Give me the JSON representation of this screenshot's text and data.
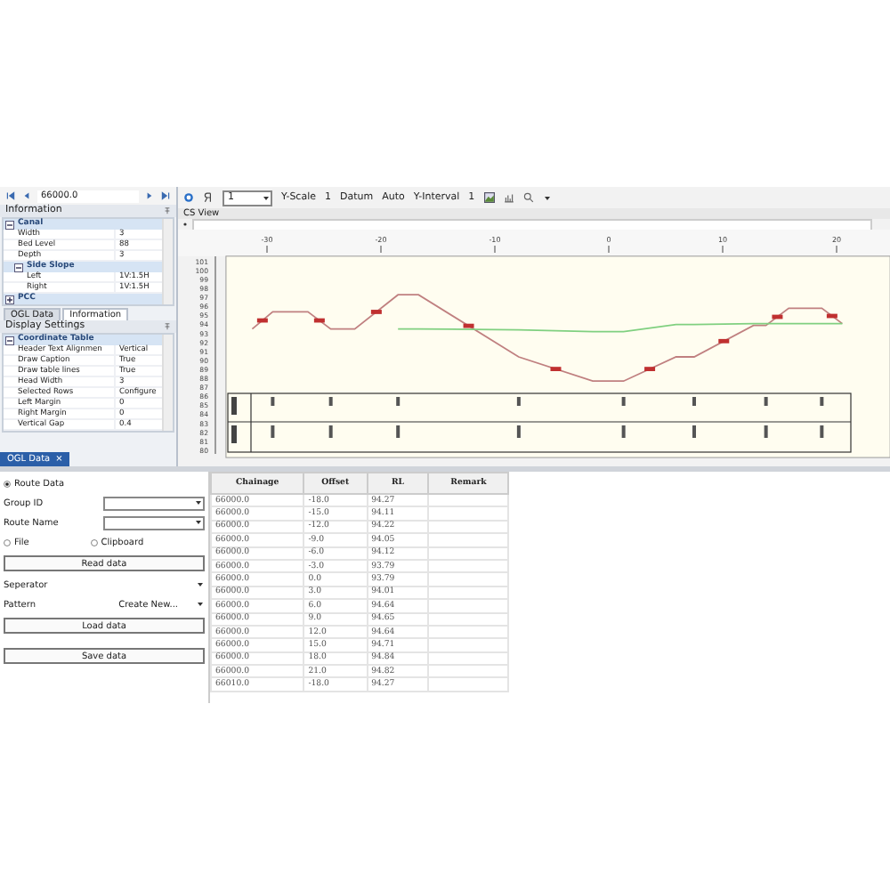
{
  "navigator": {
    "value": "66000.0"
  },
  "toolbar": {
    "scale_select": "1",
    "y_scale": {
      "label": "Y-Scale",
      "value": "1"
    },
    "datum": {
      "label": "Datum",
      "value": "Auto"
    },
    "y_interval": {
      "label": "Y-Interval",
      "value": "1"
    }
  },
  "information": {
    "title": "Information",
    "properties": [
      {
        "kind": "group",
        "label": "Canal",
        "expanded": true,
        "children": [
          {
            "kind": "row",
            "label": "Width",
            "value": "3"
          },
          {
            "kind": "row",
            "label": "Bed Level",
            "value": "88"
          },
          {
            "kind": "row",
            "label": "Depth",
            "value": "3"
          },
          {
            "kind": "group",
            "label": "Side Slope",
            "expanded": true,
            "children": [
              {
                "kind": "row",
                "label": "Left",
                "value": "1V:1.5H"
              },
              {
                "kind": "row",
                "label": "Right",
                "value": "1V:1.5H"
              }
            ]
          }
        ]
      },
      {
        "kind": "group",
        "label": "PCC",
        "expanded": false
      }
    ]
  },
  "panel_tabs": [
    {
      "label": "OGL Data",
      "selected": false
    },
    {
      "label": "Information",
      "selected": true
    }
  ],
  "display_settings": {
    "title": "Display Settings",
    "properties": [
      {
        "kind": "group",
        "label": "Coordinate Table",
        "expanded": true,
        "children": [
          {
            "kind": "row",
            "label": "Header Text Alignmen",
            "value": "Vertical"
          },
          {
            "kind": "row",
            "label": "Draw Caption",
            "value": "True"
          },
          {
            "kind": "row",
            "label": "Draw table lines",
            "value": "True"
          },
          {
            "kind": "row",
            "label": "Head Width",
            "value": "3"
          },
          {
            "kind": "row",
            "label": "Selected Rows",
            "value": "Configure"
          },
          {
            "kind": "row",
            "label": "Left Margin",
            "value": "0"
          },
          {
            "kind": "row",
            "label": "Right Margin",
            "value": "0"
          },
          {
            "kind": "row",
            "label": "Vertical Gap",
            "value": "0.4"
          }
        ]
      }
    ]
  },
  "document_tab": {
    "label": "OGL Data",
    "close": "×"
  },
  "cs_view": {
    "title": "CS View",
    "chart_data": {
      "type": "line",
      "x": [
        -31.3,
        -29.5,
        -26.4,
        -24.4,
        -22.3,
        -18.5,
        -16.7,
        -7.9,
        -1.4,
        1.3,
        5.9,
        7.5,
        12.7,
        13.8,
        15.8,
        18.7,
        20.5
      ],
      "xlim": [
        -33.6,
        24.7
      ],
      "ylim": [
        79.2,
        101.6
      ],
      "xticks": [
        -30,
        -20,
        -10,
        0,
        10,
        20
      ],
      "yticks": [
        80,
        81,
        82,
        83,
        84,
        85,
        86,
        87,
        88,
        89,
        90,
        91,
        92,
        93,
        94,
        95,
        96,
        97,
        98,
        99,
        100,
        101
      ],
      "series": [
        {
          "color": "#c08080",
          "values": [
            93.5,
            95.4,
            95.4,
            93.5,
            93.5,
            97.3,
            97.3,
            90.4,
            87.7,
            87.7,
            90.4,
            90.4,
            93.9,
            93.9,
            95.8,
            95.8,
            94.1
          ]
        },
        {
          "color": "#80d080",
          "values": [
            null,
            null,
            null,
            null,
            null,
            93.5,
            93.5,
            93.4,
            93.2,
            93.2,
            94.0,
            94.0,
            94.1,
            94.1,
            94.1,
            94.1,
            94.1
          ]
        }
      ]
    }
  },
  "route_form": {
    "route_data": {
      "label": "Route Data",
      "selected": true
    },
    "group_id": {
      "label": "Group ID"
    },
    "route_name": {
      "label": "Route Name"
    },
    "sources": [
      {
        "label": "File",
        "selected": false
      },
      {
        "label": "Clipboard",
        "selected": false
      }
    ],
    "read_button": "Read data",
    "separator": {
      "label": "Seperator"
    },
    "pattern": {
      "label": "Pattern",
      "value": "Create New..."
    },
    "load_button": "Load data",
    "save_button": "Save data"
  },
  "table": {
    "columns": [
      "Chainage",
      "Offset",
      "RL",
      "Remark"
    ],
    "rows": [
      [
        "66000.0",
        "-18.0",
        "94.27",
        ""
      ],
      [
        "66000.0",
        "-15.0",
        "94.11",
        ""
      ],
      [
        "66000.0",
        "-12.0",
        "94.22",
        ""
      ],
      [
        "66000.0",
        "-9.0",
        "94.05",
        ""
      ],
      [
        "66000.0",
        "-6.0",
        "94.12",
        ""
      ],
      [
        "66000.0",
        "-3.0",
        "93.79",
        ""
      ],
      [
        "66000.0",
        "0.0",
        "93.79",
        ""
      ],
      [
        "66000.0",
        "3.0",
        "94.01",
        ""
      ],
      [
        "66000.0",
        "6.0",
        "94.64",
        ""
      ],
      [
        "66000.0",
        "9.0",
        "94.65",
        ""
      ],
      [
        "66000.0",
        "12.0",
        "94.64",
        ""
      ],
      [
        "66000.0",
        "15.0",
        "94.71",
        ""
      ],
      [
        "66000.0",
        "18.0",
        "94.84",
        ""
      ],
      [
        "66000.0",
        "21.0",
        "94.82",
        ""
      ],
      [
        "66010.0",
        "-18.0",
        "94.27",
        ""
      ]
    ]
  }
}
